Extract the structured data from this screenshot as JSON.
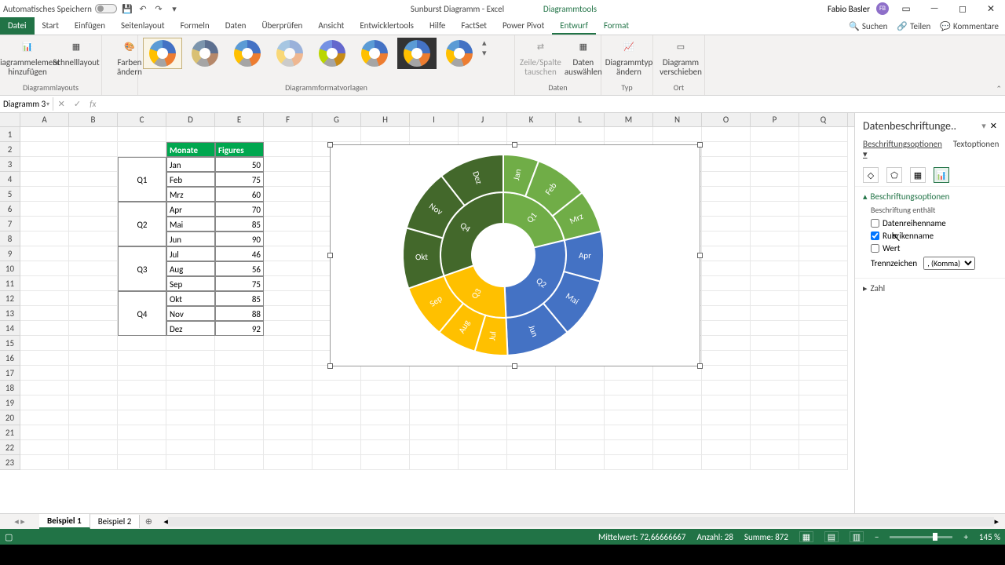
{
  "title": {
    "autosave": "Automatisches Speichern",
    "doc": "Sunburst Diagramm",
    "app": "Excel",
    "context": "Diagrammtools",
    "user": "Fabio Basler"
  },
  "tabs": {
    "file": "Datei",
    "items": [
      "Start",
      "Einfügen",
      "Seitenlayout",
      "Formeln",
      "Daten",
      "Überprüfen",
      "Ansicht",
      "Entwicklertools",
      "Hilfe",
      "FactSet",
      "Power Pivot",
      "Entwurf",
      "Format"
    ],
    "active": "Entwurf",
    "search": "Suchen",
    "share": "Teilen",
    "comments": "Kommentare"
  },
  "ribbon": {
    "layouts": {
      "add": "Diagrammelement hinzufügen",
      "quick": "Schnelllayout",
      "label": "Diagrammlayouts"
    },
    "colors": {
      "btn": "Farben ändern"
    },
    "styles": {
      "label": "Diagrammformatvorlagen"
    },
    "data": {
      "switch": "Zeile/Spalte tauschen",
      "select": "Daten auswählen",
      "label": "Daten"
    },
    "type": {
      "btn": "Diagrammtyp ändern",
      "label": "Typ"
    },
    "move": {
      "btn": "Diagramm verschieben",
      "label": "Ort"
    }
  },
  "namebox": "Diagramm 3",
  "cols": [
    "A",
    "B",
    "C",
    "D",
    "E",
    "F",
    "G",
    "H",
    "I",
    "J",
    "K",
    "L",
    "M",
    "N",
    "O",
    "P",
    "Q"
  ],
  "table": {
    "head": [
      "Monate",
      "Figures"
    ],
    "quarters": [
      "Q1",
      "Q2",
      "Q3",
      "Q4"
    ],
    "rows": [
      [
        "Jan",
        "50"
      ],
      [
        "Feb",
        "75"
      ],
      [
        "Mrz",
        "60"
      ],
      [
        "Apr",
        "70"
      ],
      [
        "Mai",
        "85"
      ],
      [
        "Jun",
        "90"
      ],
      [
        "Jul",
        "46"
      ],
      [
        "Aug",
        "56"
      ],
      [
        "Sep",
        "75"
      ],
      [
        "Okt",
        "85"
      ],
      [
        "Nov",
        "88"
      ],
      [
        "Dez",
        "92"
      ]
    ]
  },
  "chart_data": {
    "type": "pie",
    "title": "",
    "hierarchy": [
      {
        "name": "Q1",
        "color": "#70ad47",
        "children": [
          {
            "name": "Jan",
            "value": 50
          },
          {
            "name": "Feb",
            "value": 75
          },
          {
            "name": "Mrz",
            "value": 60
          }
        ]
      },
      {
        "name": "Q2",
        "color": "#4472c4",
        "children": [
          {
            "name": "Apr",
            "value": 70
          },
          {
            "name": "Mai",
            "value": 85
          },
          {
            "name": "Jun",
            "value": 90
          }
        ]
      },
      {
        "name": "Q3",
        "color": "#ffc000",
        "children": [
          {
            "name": "Jul",
            "value": 46
          },
          {
            "name": "Aug",
            "value": 56
          },
          {
            "name": "Sep",
            "value": 75
          }
        ]
      },
      {
        "name": "Q4",
        "color": "#43682b",
        "children": [
          {
            "name": "Okt",
            "value": 85
          },
          {
            "name": "Nov",
            "value": 88
          },
          {
            "name": "Dez",
            "value": 92
          }
        ]
      }
    ]
  },
  "pane": {
    "title": "Datenbeschriftunge..",
    "tab1": "Beschriftungsoptionen",
    "tab2": "Textoptionen",
    "section": "Beschriftungsoptionen",
    "contains": "Beschriftung enthält",
    "seriesname": "Datenreihenname",
    "catname": "Rubrikenname",
    "value": "Wert",
    "separator": "Trennzeichen",
    "sep_val": ", (Komma)",
    "number": "Zahl"
  },
  "sheets": {
    "s1": "Beispiel 1",
    "s2": "Beispiel 2"
  },
  "status": {
    "avg": "Mittelwert: 72,66666667",
    "count": "Anzahl: 28",
    "sum": "Summe: 872",
    "zoom": "145 %"
  }
}
